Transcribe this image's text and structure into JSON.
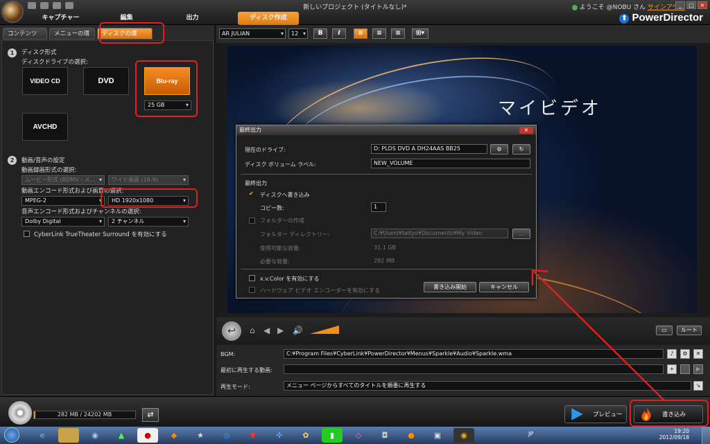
{
  "window": {
    "title": "新しいプロジェクト (タイトルなし)*"
  },
  "main_tabs": [
    "キャプチャー",
    "編集",
    "出力",
    "ディスク作成"
  ],
  "user": {
    "greeting": "ようこそ @NOBU さん",
    "signout": "サインアウト"
  },
  "brand": "PowerDirector",
  "sub_tabs": [
    "コンテンツ",
    "メニューの環境...",
    "ディスクの環境..."
  ],
  "disc_format": {
    "title": "ディスク形式",
    "drive_label": "ディスクドライブの選択:",
    "options": [
      "VIDEO CD",
      "DVD",
      "Blu-ray",
      "AVCHD"
    ],
    "capacity": "25 GB"
  },
  "video_audio": {
    "title": "動画/音声の設定",
    "recording_label": "動画録画形式の選択:",
    "recording_format": "ムービー形式 (BDMV - メ...",
    "aspect": "ワイド画面 (16:9)",
    "encode_label": "動画エンコード形式および画質の選択:",
    "video_codec": "MPEG-2",
    "video_quality": "HD 1920x1080",
    "audio_label": "音声エンコード形式およびチャンネルの選択:",
    "audio_codec": "Dolby Digital",
    "audio_channels": "2 チャンネル",
    "truetheater": "CyberLink TrueTheater Surround を有効にする"
  },
  "text_toolbar": {
    "font": "AR JULIAN",
    "size": "12",
    "bold": "B",
    "italic": "I"
  },
  "preview": {
    "title": "マイビデオ"
  },
  "dialog": {
    "title": "最終出力",
    "drive_label": "現在のドライブ:",
    "drive_value": "D: PLDS    DVD A   DH24AAS  BB25",
    "volume_label": "ディスク ボリューム ラベル:",
    "volume_value": "NEW_VOLUME",
    "section": "最終出力",
    "write_to_disc": "ディスクへ書き込み",
    "copies_label": "コピー数:",
    "copies_value": "1",
    "create_folder": "フォルダーの作成",
    "folder_dir_label": "フォルダー ディレクトリー:",
    "folder_dir_value": "C:¥Users¥taityo¥Documents¥My Video",
    "browse": "...",
    "available_label": "使用可能な容量:",
    "available_value": "31.1 GB",
    "required_label": "必要な容量:",
    "required_value": "282 MB",
    "xvcolor": "x.v.Color を有効にする",
    "hw_encoder": "ハードウェア ビデオ エンコーダーを有効にする",
    "start_button": "書き込み開始",
    "cancel_button": "キャンセル"
  },
  "playback": {
    "root_button": "ルート"
  },
  "menu_settings": {
    "bgm_label": "BGM:",
    "bgm_value": "C:¥Program Files¥CyberLink¥PowerDirector¥Menus¥Sparkle¥Audio¥Sparkle.wma",
    "first_play_label": "最初に再生する動画:",
    "first_play_value": "",
    "mode_label": "再生モード:",
    "mode_value": "メニュー ページからすべてのタイトルを順番に再生する"
  },
  "bottom": {
    "space": "282 MB / 24202 MB",
    "space_fraction": 0.012,
    "preview_button": "プレビュー",
    "burn_button": "書き込み"
  },
  "taskbar": {
    "lang": "JP",
    "time": "19:20",
    "date": "2012/09/18"
  },
  "colors": {
    "accent": "#f7a23d",
    "annotation_red": "#e0201c"
  }
}
